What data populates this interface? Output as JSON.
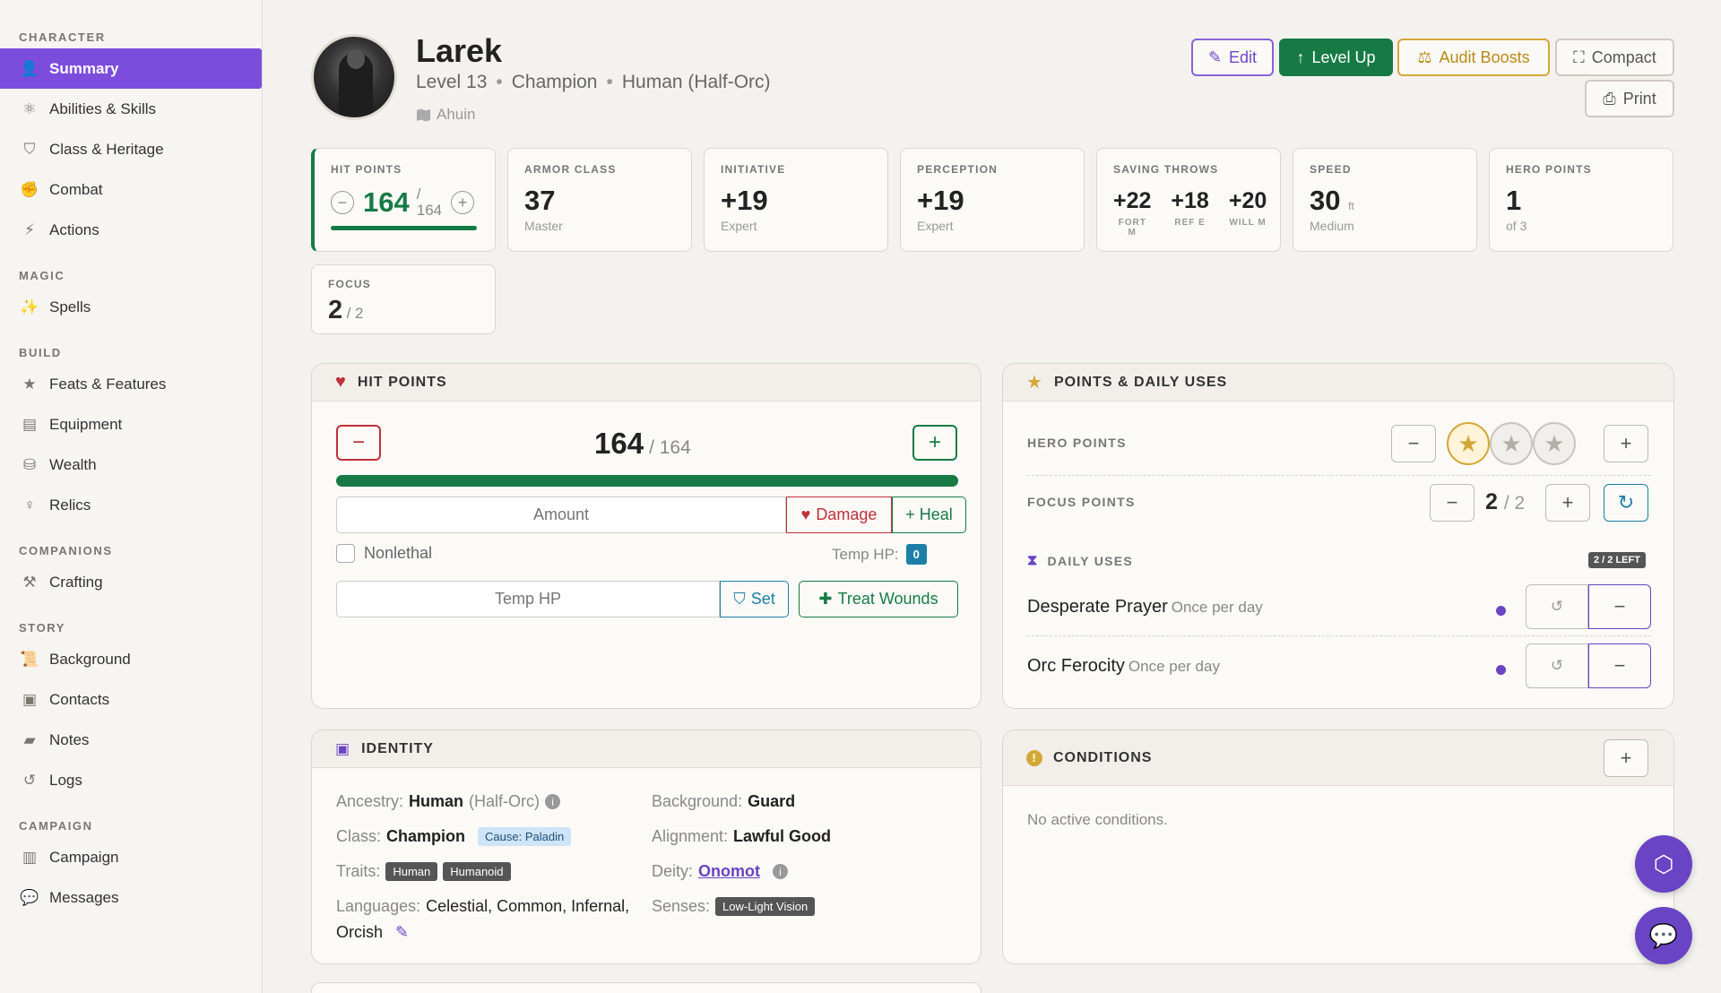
{
  "sidebar": {
    "sections": [
      {
        "title": "CHARACTER",
        "items": [
          {
            "label": "Summary",
            "icon": "person-icon",
            "glyph": "👤",
            "active": true
          },
          {
            "label": "Abilities & Skills",
            "icon": "atom-icon",
            "glyph": "⚛"
          },
          {
            "label": "Class & Heritage",
            "icon": "shield-icon",
            "glyph": "⛉"
          },
          {
            "label": "Combat",
            "icon": "fist-icon",
            "glyph": "✊"
          },
          {
            "label": "Actions",
            "icon": "bolt-icon",
            "glyph": "⚡"
          }
        ]
      },
      {
        "title": "MAGIC",
        "items": [
          {
            "label": "Spells",
            "icon": "wand-icon",
            "glyph": "✨"
          }
        ]
      },
      {
        "title": "BUILD",
        "items": [
          {
            "label": "Feats & Features",
            "icon": "star-icon",
            "glyph": "★"
          },
          {
            "label": "Equipment",
            "icon": "box-icon",
            "glyph": "▤"
          },
          {
            "label": "Wealth",
            "icon": "coins-icon",
            "glyph": "⛁"
          },
          {
            "label": "Relics",
            "icon": "key-icon",
            "glyph": "♀"
          }
        ]
      },
      {
        "title": "COMPANIONS",
        "items": [
          {
            "label": "Crafting",
            "icon": "hammer-icon",
            "glyph": "⚒"
          }
        ]
      },
      {
        "title": "STORY",
        "items": [
          {
            "label": "Background",
            "icon": "scroll-icon",
            "glyph": "📜"
          },
          {
            "label": "Contacts",
            "icon": "address-book-icon",
            "glyph": "▣"
          },
          {
            "label": "Notes",
            "icon": "note-icon",
            "glyph": "▰"
          },
          {
            "label": "Logs",
            "icon": "history-icon",
            "glyph": "↺"
          }
        ]
      },
      {
        "title": "CAMPAIGN",
        "items": [
          {
            "label": "Campaign",
            "icon": "map-icon",
            "glyph": "▥"
          },
          {
            "label": "Messages",
            "icon": "chat-icon",
            "glyph": "💬"
          }
        ]
      }
    ]
  },
  "header": {
    "name": "Larek",
    "level": "Level 13",
    "class": "Champion",
    "ancestry": "Human (Half-Orc)",
    "player": "Ahuin",
    "buttons": {
      "edit": "Edit",
      "level_up": "Level Up",
      "audit": "Audit Boosts",
      "compact": "Compact",
      "print": "Print"
    }
  },
  "stats": {
    "hp": {
      "label": "HIT POINTS",
      "current": "164",
      "slash": "/",
      "max": "164",
      "fill": 1.0
    },
    "ac": {
      "label": "ARMOR CLASS",
      "value": "37",
      "sub": "Master"
    },
    "initiative": {
      "label": "INITIATIVE",
      "value": "+19",
      "sub": "Expert"
    },
    "perception": {
      "label": "PERCEPTION",
      "value": "+19",
      "sub": "Expert"
    },
    "saves": {
      "label": "SAVING THROWS",
      "fort": "+22",
      "fort_lbl": "FORT M",
      "ref": "+18",
      "ref_lbl": "REF E",
      "will": "+20",
      "will_lbl": "WILL M"
    },
    "speed": {
      "label": "SPEED",
      "value": "30",
      "unit": "ft",
      "sub": "Medium"
    },
    "hero": {
      "label": "HERO POINTS",
      "value": "1",
      "sub": "of 3"
    },
    "focus": {
      "label": "FOCUS",
      "value": "2",
      "max": "/ 2"
    }
  },
  "hp_panel": {
    "title": "HIT POINTS",
    "current": "164",
    "max": "/ 164",
    "fill": 1.0,
    "amount_placeholder": "Amount",
    "damage": "Damage",
    "heal": "+ Heal",
    "nonlethal": "Nonlethal",
    "temp_label": "Temp HP:",
    "temp_value": "0",
    "temp_placeholder": "Temp HP",
    "set": "Set",
    "treat": "Treat Wounds"
  },
  "points_panel": {
    "title": "POINTS & DAILY USES",
    "hero_label": "HERO POINTS",
    "hero_current": 1,
    "hero_max": 3,
    "focus_label": "FOCUS POINTS",
    "focus_value": "2",
    "focus_max": "/ 2",
    "daily_label": "DAILY USES",
    "daily_badge": "2 / 2 LEFT",
    "daily": [
      {
        "name": "Desperate Prayer",
        "freq": "Once per day"
      },
      {
        "name": "Orc Ferocity",
        "freq": "Once per day"
      }
    ]
  },
  "identity": {
    "title": "IDENTITY",
    "ancestry_lbl": "Ancestry:",
    "ancestry": "Human",
    "ancestry_extra": "(Half-Orc)",
    "class_lbl": "Class:",
    "class": "Champion",
    "cause": "Cause: Paladin",
    "traits_lbl": "Traits:",
    "traits": [
      "Human",
      "Humanoid"
    ],
    "languages_lbl": "Languages:",
    "languages_1": "Celestial, Common, Infernal,",
    "languages_2": "Orcish",
    "background_lbl": "Background:",
    "background": "Guard",
    "alignment_lbl": "Alignment:",
    "alignment": "Lawful Good",
    "deity_lbl": "Deity:",
    "deity": "Onomot",
    "senses_lbl": "Senses:",
    "senses": "Low-Light Vision"
  },
  "conditions": {
    "title": "CONDITIONS",
    "empty": "No active conditions."
  }
}
